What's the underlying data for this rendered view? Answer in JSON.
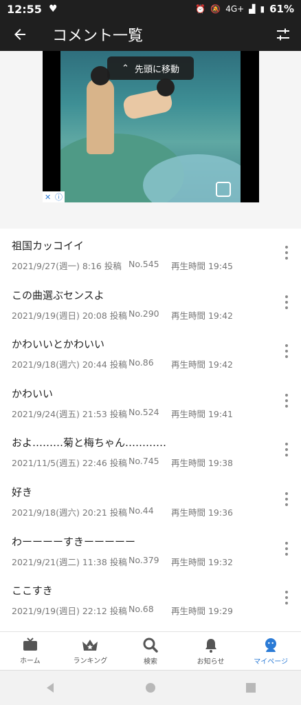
{
  "status": {
    "time": "12:55",
    "network": "4G+",
    "battery": "61%"
  },
  "header": {
    "title": "コメント一覧"
  },
  "ad": {
    "to_top_label": "先頭に移動"
  },
  "comments": [
    {
      "text": "祖国カッコイイ",
      "date": "2021/9/27(週一) 8:16 投稿",
      "no": "No.545",
      "time": "再生時間 19:45"
    },
    {
      "text": "この曲選ぶセンスよ",
      "date": "2021/9/19(週日) 20:08 投稿",
      "no": "No.290",
      "time": "再生時間 19:42"
    },
    {
      "text": "かわいいとかわいい",
      "date": "2021/9/18(週六) 20:44 投稿",
      "no": "No.86",
      "time": "再生時間 19:42"
    },
    {
      "text": "かわいい",
      "date": "2021/9/24(週五) 21:53 投稿",
      "no": "No.524",
      "time": "再生時間 19:41"
    },
    {
      "text": "およ………菊と梅ちゃん…………",
      "date": "2021/11/5(週五) 22:46 投稿",
      "no": "No.745",
      "time": "再生時間 19:38"
    },
    {
      "text": "好き",
      "date": "2021/9/18(週六) 20:21 投稿",
      "no": "No.44",
      "time": "再生時間 19:36"
    },
    {
      "text": "わーーーーすきーーーーー",
      "date": "2021/9/21(週二) 11:38 投稿",
      "no": "No.379",
      "time": "再生時間 19:32"
    },
    {
      "text": "ここすき",
      "date": "2021/9/19(週日) 22:12 投稿",
      "no": "No.68",
      "time": "再生時間 19:29"
    }
  ],
  "tabs": [
    {
      "label": "ホーム",
      "icon": "tv-icon"
    },
    {
      "label": "ランキング",
      "icon": "crown-icon"
    },
    {
      "label": "検索",
      "icon": "search-icon"
    },
    {
      "label": "お知らせ",
      "icon": "bell-icon"
    },
    {
      "label": "マイページ",
      "icon": "user-icon",
      "active": true
    }
  ],
  "colors": {
    "accent": "#2b7bd6",
    "bar": "#1f1f1f"
  }
}
